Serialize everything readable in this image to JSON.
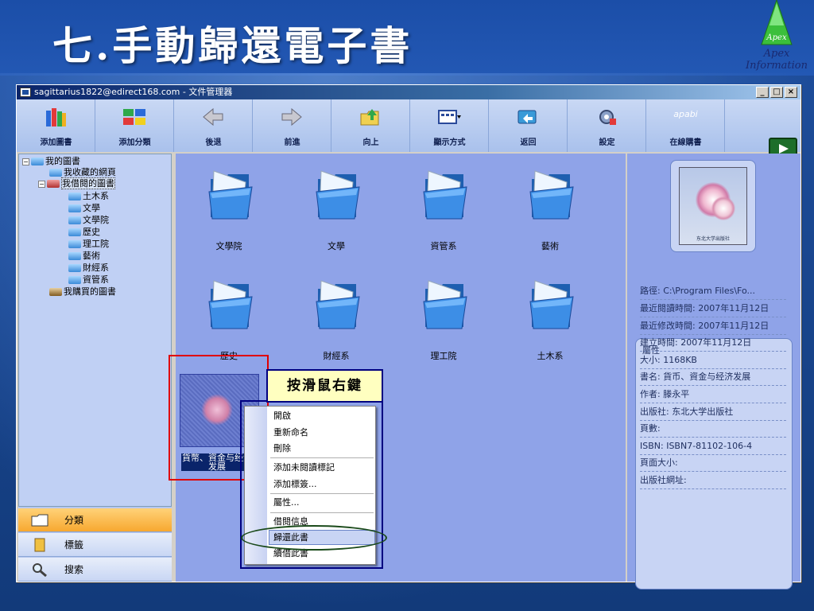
{
  "slide": {
    "title": "七.手動歸還電子書",
    "logo_text": "Apex",
    "brand": "Apex Information"
  },
  "window": {
    "title": "sagittarius1822@edirect168.com - 文件管理器",
    "controls": [
      "_",
      "□",
      "×"
    ]
  },
  "toolbar": {
    "items": [
      {
        "label": "添加圖書",
        "icon": "books-icon"
      },
      {
        "label": "添加分類",
        "icon": "categories-icon"
      },
      {
        "label": "後退",
        "icon": "back-arrow-icon"
      },
      {
        "label": "前進",
        "icon": "forward-arrow-icon"
      },
      {
        "label": "向上",
        "icon": "up-folder-icon"
      },
      {
        "label": "顯示方式",
        "icon": "view-mode-icon"
      },
      {
        "label": "返回",
        "icon": "return-icon"
      },
      {
        "label": "設定",
        "icon": "settings-icon"
      },
      {
        "label": "在線購書",
        "icon": "apabi-logo-icon"
      }
    ],
    "apabi_text": "apabi"
  },
  "tree": {
    "nodes": [
      {
        "label": "我的圖書",
        "toggle": "−",
        "level": 0
      },
      {
        "label": "我收藏的網頁",
        "toggle": "",
        "level": 1
      },
      {
        "label": "我借閱的圖書",
        "toggle": "−",
        "level": 1
      },
      {
        "label": "土木系",
        "toggle": "",
        "level": 2
      },
      {
        "label": "文學",
        "toggle": "",
        "level": 2
      },
      {
        "label": "文學院",
        "toggle": "",
        "level": 2
      },
      {
        "label": "歷史",
        "toggle": "",
        "level": 2
      },
      {
        "label": "理工院",
        "toggle": "",
        "level": 2
      },
      {
        "label": "藝術",
        "toggle": "",
        "level": 2
      },
      {
        "label": "財經系",
        "toggle": "",
        "level": 2
      },
      {
        "label": "資管系",
        "toggle": "",
        "level": 2
      },
      {
        "label": "我購買的圖書",
        "toggle": "",
        "level": 1
      }
    ]
  },
  "left_panel": {
    "items": [
      {
        "label": "分類",
        "active": true
      },
      {
        "label": "標籤",
        "active": false
      },
      {
        "label": "搜索",
        "active": false
      }
    ]
  },
  "main": {
    "folders": [
      "文學院",
      "文學",
      "資管系",
      "藝術",
      "歷史",
      "財經系",
      "理工院",
      "土木系"
    ],
    "book_caption": "貨幣、資金与经济发展"
  },
  "callout": "按滑鼠右鍵",
  "context_menu": {
    "items": [
      "開啟",
      "重新命名",
      "刪除",
      "添加未閱讀標記",
      "添加標簽...",
      "屬性...",
      "借閱信息",
      "歸還此書",
      "續借此書"
    ],
    "highlighted": "歸還此書"
  },
  "right_panel": {
    "cover_publisher": "东北大学出版社",
    "props_title": "屬性",
    "props": [
      "路徑: C:\\Program Files\\Fo...",
      "最近閱讀時間: 2007年11月12日",
      "最近修改時間: 2007年11月12日",
      "建立時間: 2007年11月12日",
      "大小: 1168KB",
      "書名: 貨币、資金与经济发展",
      "作者: 滕永平",
      "出版社: 东北大学出版社",
      "頁數:",
      "ISBN: ISBN7-81102-106-4",
      "頁面大小:",
      "出版社網址:"
    ]
  },
  "colors": {
    "slide_bg": "#1f4f9e",
    "panel_bg": "#8fa3e8",
    "tree_bg": "#c0d0f4",
    "active_tab": "#f7a830",
    "annotation_red": "#e00000",
    "annotation_blue": "#000080",
    "annotation_green": "#1a4a1a"
  }
}
